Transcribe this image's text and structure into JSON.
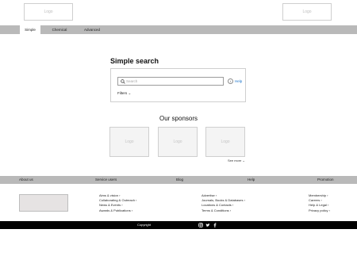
{
  "header": {
    "logo_left": "Logo",
    "logo_right": "Logo"
  },
  "tabs": [
    {
      "label": "Simple",
      "active": true
    },
    {
      "label": "Chemical",
      "active": false
    },
    {
      "label": "Advanced",
      "active": false
    }
  ],
  "search": {
    "title": "Simple search",
    "placeholder": "Search",
    "help_label": "Help",
    "filters_label": "Filters ⌄"
  },
  "sponsors": {
    "title": "Our sponsors",
    "items": [
      "Logo",
      "Logo",
      "Logo"
    ],
    "see_more": "See more ⌄"
  },
  "footer": {
    "headers": [
      "About us",
      "Service users",
      "Blog",
      "Help",
      "Promotion"
    ],
    "col1": [
      "Aims & vision ›",
      "Collaborating & Outreach ›",
      "News & Events ›",
      "Awards & Publications ›"
    ],
    "col2": [
      "Advertise ›",
      "Journals, Books & Databases ›",
      "Locations & Contacts ›",
      "Terms & Conditions ›"
    ],
    "col3": [
      "Membership ›",
      "Careers ›",
      "Help & Legal ›",
      "Privacy policy ›"
    ],
    "copyright": "Copyright"
  },
  "icons": [
    "instagram-icon",
    "twitter-icon",
    "facebook-icon",
    "search-icon",
    "help-icon"
  ]
}
